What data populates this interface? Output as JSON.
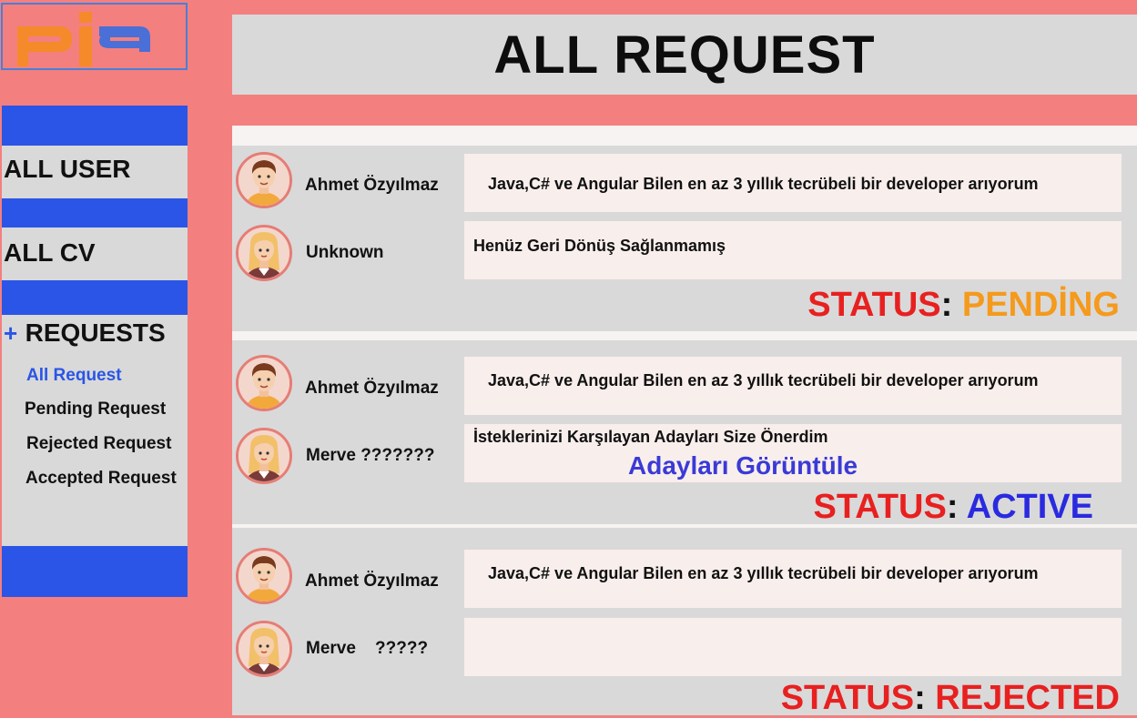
{
  "logo": {
    "text": "pia"
  },
  "header": {
    "title": "ALL REQUEST"
  },
  "sidebar": {
    "all_user": "ALL USER",
    "all_cv": "ALL CV",
    "requests_plus": "+",
    "requests": "REQUESTS",
    "items": [
      {
        "label": "All Request"
      },
      {
        "label": "Pending Request"
      },
      {
        "label": "Rejected Request"
      },
      {
        "label": "Accepted Request"
      }
    ]
  },
  "colors": {
    "accent_blue": "#2a55e6",
    "sidebar_bg": "#f47f7f",
    "status_red": "#e82020",
    "pending": "#f59a1c",
    "active": "#2a2ae0",
    "rejected": "#e82020"
  },
  "requests": [
    {
      "requester": "Ahmet Özyılmaz",
      "request_text": "Java,C# ve Angular Bilen en az 3 yıllık tecrübeli bir developer arıyorum",
      "responder": "Unknown",
      "response_text": "Henüz Geri Dönüş Sağlanmamış",
      "status_label": "STATUS",
      "status_colon": ":",
      "status_value": "PENDİNG"
    },
    {
      "requester": "Ahmet Özyılmaz",
      "request_text": "Java,C# ve Angular Bilen en az 3 yıllık tecrübeli bir developer arıyorum",
      "responder": "Merve ???????",
      "response_text": "İsteklerinizi Karşılayan Adayları Size Önerdim",
      "response_link": "Adayları Görüntüle",
      "status_label": "STATUS",
      "status_colon": ":",
      "status_value": "ACTIVE"
    },
    {
      "requester": "Ahmet Özyılmaz",
      "request_text": "Java,C# ve Angular Bilen en az 3 yıllık tecrübeli bir developer arıyorum",
      "responder": "Merve    ?????",
      "response_text": "",
      "status_label": "STATUS",
      "status_colon": ":",
      "status_value": "REJECTED"
    }
  ]
}
